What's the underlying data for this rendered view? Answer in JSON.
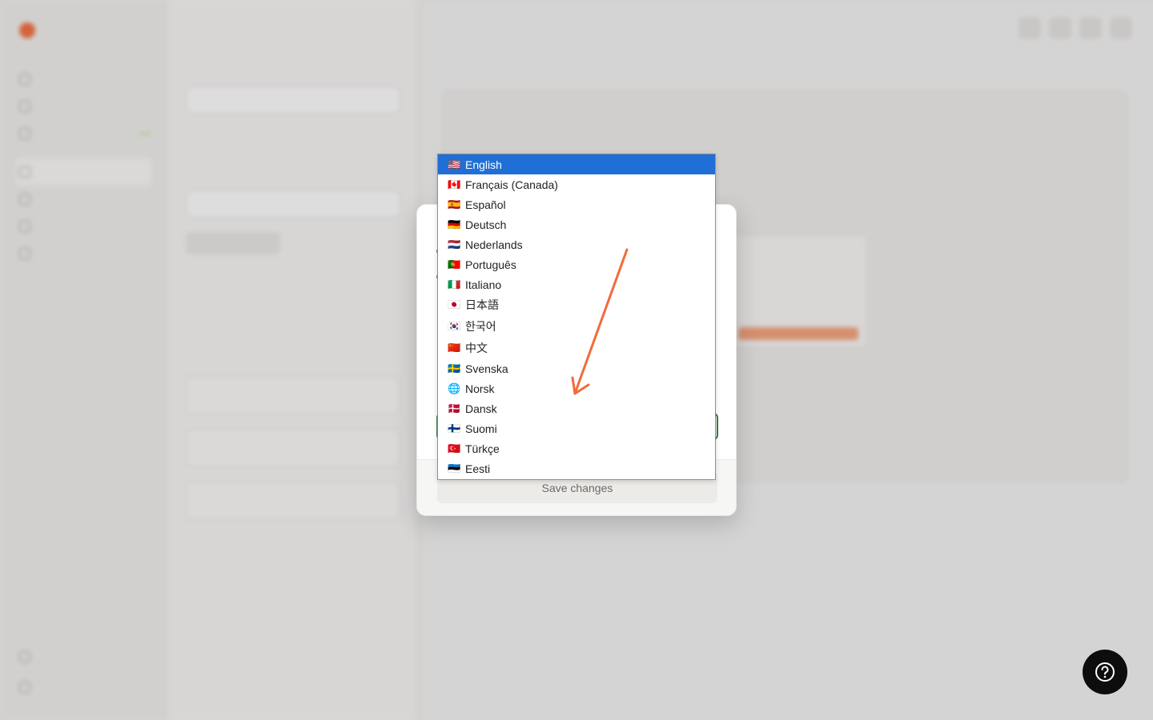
{
  "languages": [
    {
      "flag": "🇺🇸",
      "label": "English",
      "selected": true
    },
    {
      "flag": "🇨🇦",
      "label": "Français (Canada)"
    },
    {
      "flag": "🇪🇸",
      "label": "Español"
    },
    {
      "flag": "🇩🇪",
      "label": "Deutsch"
    },
    {
      "flag": "🇳🇱",
      "label": "Nederlands"
    },
    {
      "flag": "🇵🇹",
      "label": "Português"
    },
    {
      "flag": "🇮🇹",
      "label": "Italiano"
    },
    {
      "flag": "🇯🇵",
      "label": "日本語"
    },
    {
      "flag": "🇰🇷",
      "label": "한국어"
    },
    {
      "flag": "🇨🇳",
      "label": "中文"
    },
    {
      "flag": "🇸🇪",
      "label": "Svenska"
    },
    {
      "flag": "🌐",
      "label": "Norsk"
    },
    {
      "flag": "🇩🇰",
      "label": "Dansk"
    },
    {
      "flag": "🇫🇮",
      "label": "Suomi"
    },
    {
      "flag": "🇹🇷",
      "label": "Türkçe"
    },
    {
      "flag": "🇪🇪",
      "label": "Eesti"
    }
  ],
  "modal": {
    "save_label": "Save changes"
  },
  "colors": {
    "selected_bg": "#1f6fd6",
    "arrow": "#f26b3a",
    "accent": "#f26b3a",
    "fab": "#0d0d0d"
  },
  "icons": {
    "help": "help-icon",
    "arrow": "annotation-arrow"
  }
}
